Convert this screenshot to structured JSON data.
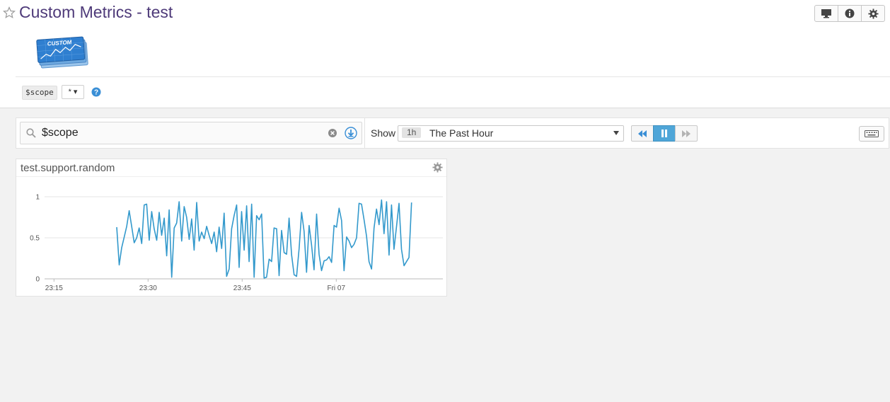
{
  "header": {
    "title": "Custom Metrics - test",
    "logo_text": "CUSTOM"
  },
  "template_vars": {
    "name": "$scope",
    "value": "* ▾"
  },
  "search": {
    "value": "$scope"
  },
  "timeframe": {
    "show_label": "Show",
    "badge": "1h",
    "label": "The Past Hour"
  },
  "colors": {
    "title": "#4e3a79",
    "accent": "#4fa6d8",
    "series": "#3399cc"
  },
  "icons": [
    "star-icon",
    "monitor-icon",
    "info-icon",
    "gear-icon",
    "help-icon",
    "search-icon",
    "clear-icon",
    "save-icon",
    "rewind-icon",
    "pause-icon",
    "forward-icon",
    "keyboard-icon"
  ],
  "widget": {
    "title": "test.support.random"
  },
  "chart_data": {
    "type": "line",
    "title": "test.support.random",
    "xlabel": "",
    "ylabel": "",
    "ylim": [
      0,
      1
    ],
    "yticks": [
      "0",
      "0.5",
      "1"
    ],
    "xticks": [
      {
        "label": "23:15",
        "t": 0
      },
      {
        "label": "23:30",
        "t": 15
      },
      {
        "label": "23:45",
        "t": 30
      },
      {
        "label": "Fri 07",
        "t": 45
      }
    ],
    "xlim": [
      -1.5,
      62
    ],
    "grid": true,
    "series": [
      {
        "color": "#3399cc",
        "t_start": 10,
        "t_end": 57,
        "values": [
          0.63,
          0.17,
          0.38,
          0.51,
          0.64,
          0.83,
          0.64,
          0.44,
          0.5,
          0.62,
          0.43,
          0.9,
          0.91,
          0.47,
          0.82,
          0.61,
          0.47,
          0.81,
          0.53,
          0.74,
          0.28,
          0.84,
          0.02,
          0.62,
          0.68,
          0.94,
          0.46,
          0.88,
          0.75,
          0.48,
          0.73,
          0.35,
          0.93,
          0.46,
          0.57,
          0.49,
          0.64,
          0.53,
          0.43,
          0.57,
          0.33,
          0.63,
          0.37,
          0.8,
          0.03,
          0.12,
          0.61,
          0.77,
          0.9,
          0.14,
          0.82,
          0.35,
          0.89,
          0.21,
          0.91,
          0.02,
          0.77,
          0.72,
          0.79,
          0.01,
          0.02,
          0.24,
          0.21,
          0.62,
          0.61,
          0.04,
          0.59,
          0.32,
          0.3,
          0.74,
          0.29,
          0.05,
          0.03,
          0.37,
          0.81,
          0.58,
          0.08,
          0.65,
          0.41,
          0.11,
          0.79,
          0.3,
          0.1,
          0.22,
          0.23,
          0.27,
          0.2,
          0.65,
          0.63,
          0.86,
          0.71,
          0.1,
          0.51,
          0.46,
          0.38,
          0.42,
          0.5,
          0.92,
          0.91,
          0.72,
          0.52,
          0.21,
          0.12,
          0.62,
          0.85,
          0.66,
          0.96,
          0.55,
          0.94,
          0.29,
          0.9,
          0.36,
          0.64,
          0.92,
          0.36,
          0.16,
          0.21,
          0.26,
          0.93
        ]
      }
    ]
  }
}
